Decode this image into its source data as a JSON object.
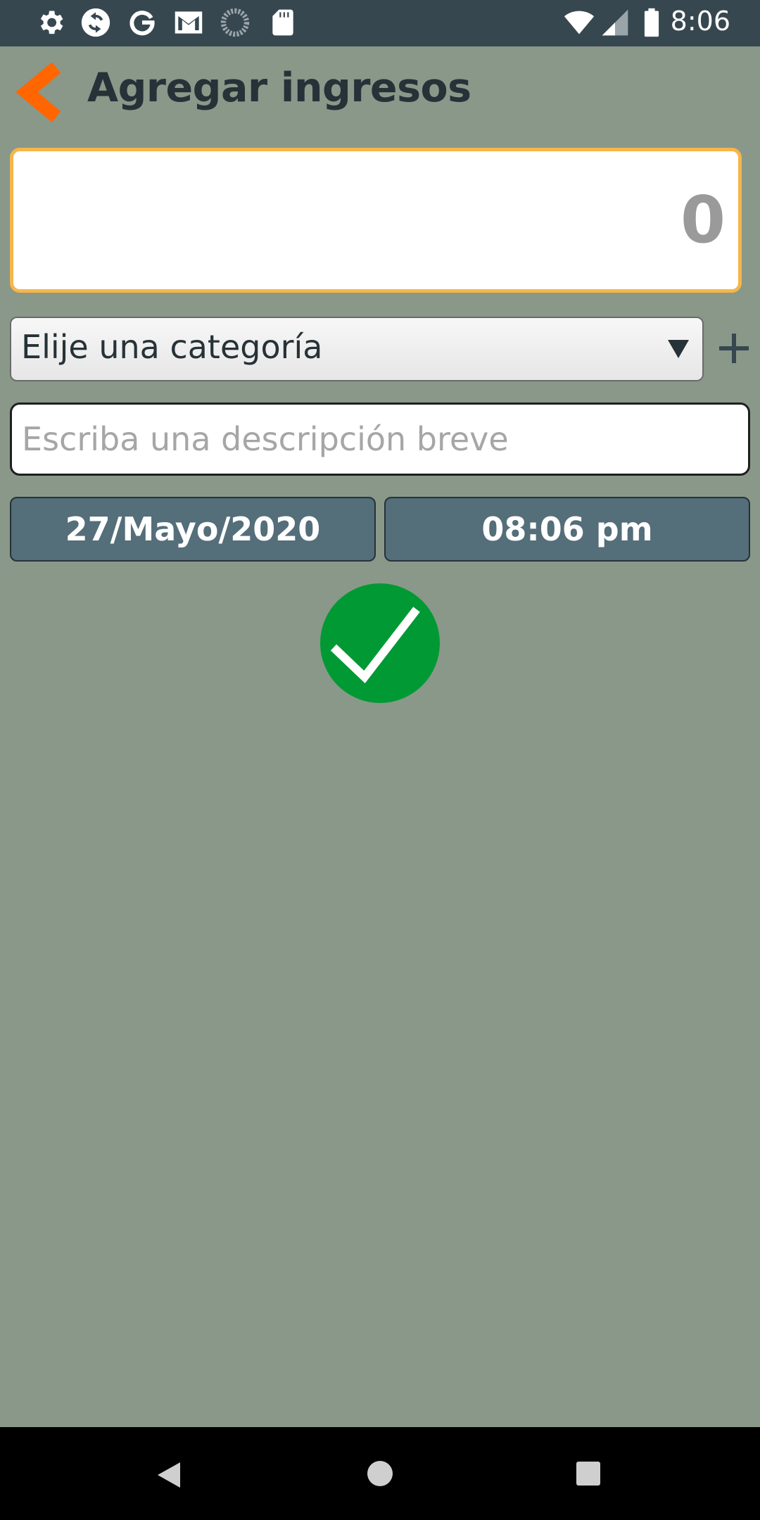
{
  "status_bar": {
    "time": "8:06",
    "left_icons": [
      "settings-icon",
      "sync-icon",
      "google-icon",
      "gmail-icon",
      "loading-icon",
      "sd-card-icon"
    ],
    "right_icons": [
      "wifi-icon",
      "cellular-signal-icon",
      "battery-icon"
    ]
  },
  "header": {
    "title": "Agregar ingresos",
    "back_icon": "chevron-left-icon",
    "accent_color": "#ff6600"
  },
  "amount": {
    "value": "0",
    "border_color": "#f6b64a"
  },
  "category": {
    "selected": "Elije una categoría",
    "add_icon": "plus-icon"
  },
  "description": {
    "placeholder": "Escriba una descripción breve",
    "value": ""
  },
  "date_button": {
    "label": "27/Mayo/2020"
  },
  "time_button": {
    "label": "08:06 pm"
  },
  "confirm": {
    "icon": "checkmark-icon",
    "color": "#009933"
  },
  "colors": {
    "background": "#899889",
    "status_bar": "#37474f",
    "button": "#546e7a"
  },
  "nav_bar": {
    "icons": [
      "nav-back-icon",
      "nav-home-icon",
      "nav-recents-icon"
    ]
  }
}
